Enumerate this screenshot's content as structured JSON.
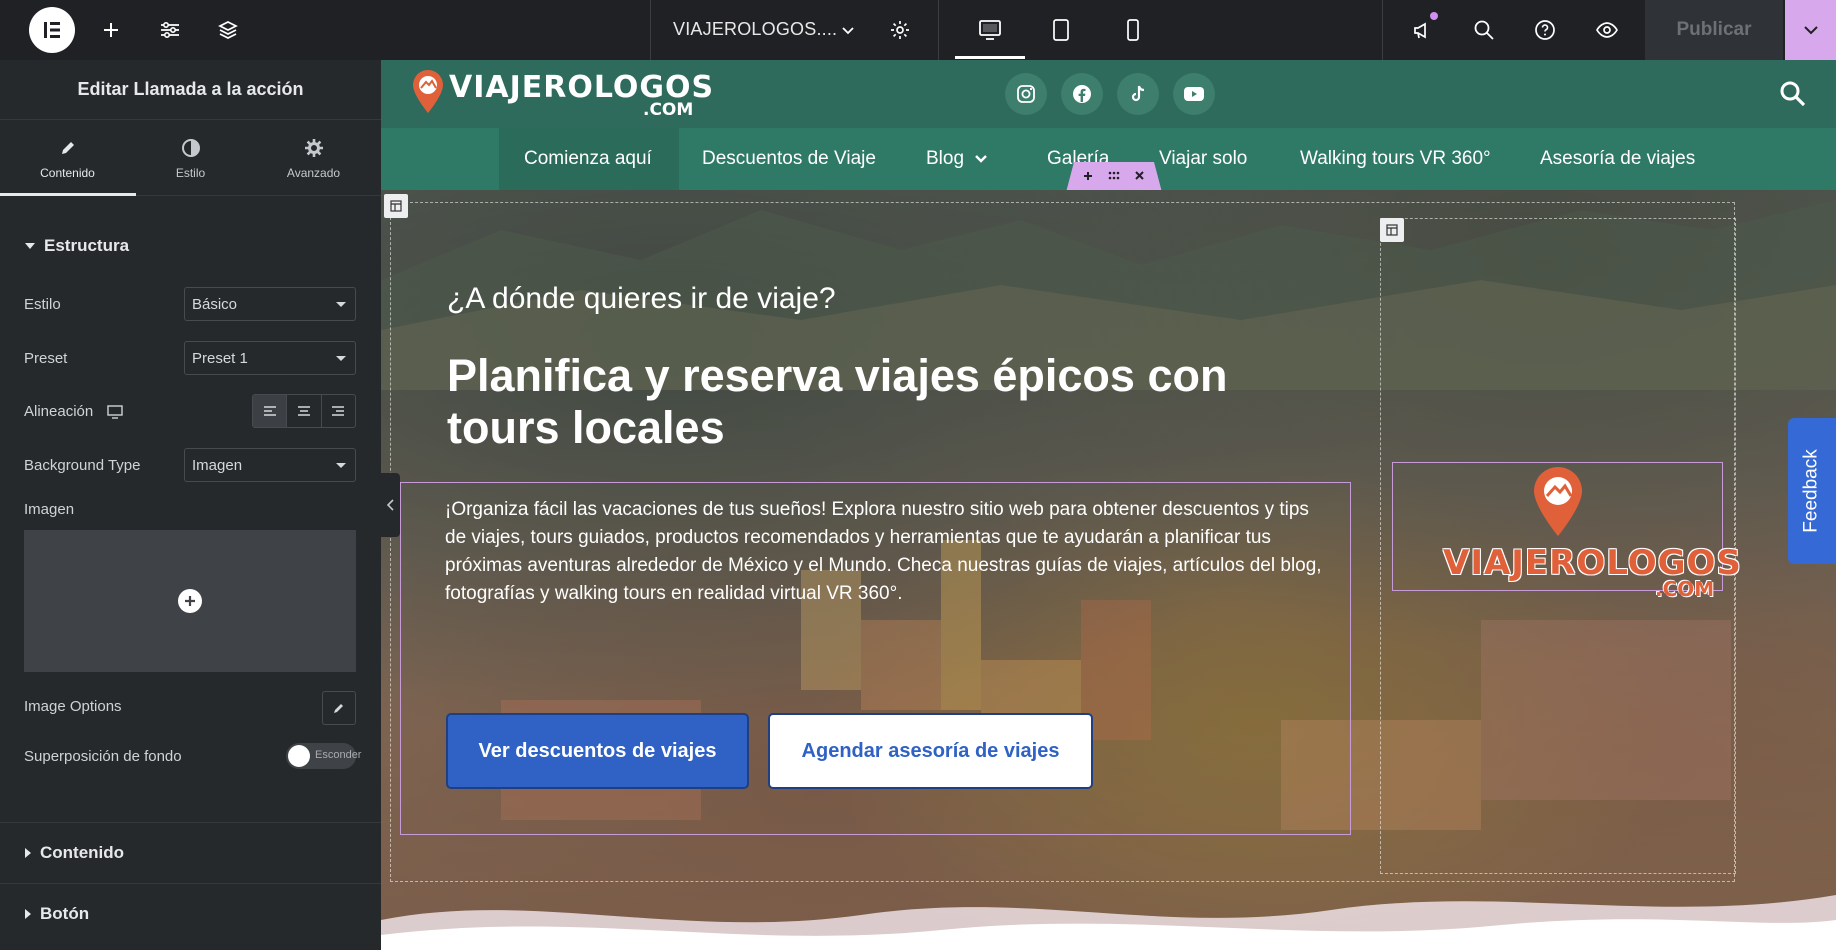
{
  "topbar": {
    "site_title": "VIAJEROLOGOS....",
    "publish_label": "Publicar"
  },
  "panel": {
    "title": "Editar Llamada a la acción",
    "tabs": [
      {
        "label": "Contenido",
        "icon": "pencil-icon"
      },
      {
        "label": "Estilo",
        "icon": "contrast-icon"
      },
      {
        "label": "Avanzado",
        "icon": "gear-icon"
      }
    ],
    "section_structure": "Estructura",
    "fields": {
      "style_label": "Estilo",
      "style_value": "Básico",
      "preset_label": "Preset",
      "preset_value": "Preset 1",
      "align_label": "Alineación",
      "bgtype_label": "Background Type",
      "bgtype_value": "Imagen",
      "image_label": "Imagen",
      "image_options_label": "Image Options",
      "overlay_label": "Superposición de fondo",
      "overlay_toggle": "Esconder"
    },
    "section_content": "Contenido",
    "section_button": "Botón"
  },
  "site": {
    "logo_main": "VIAJEROLOGOS",
    "logo_sub": ".COM",
    "nav": [
      "Comienza aquí",
      "Descuentos de Viaje",
      "Blog",
      "Galería",
      "Viajar solo",
      "Walking tours VR 360°",
      "Asesoría de viajes"
    ],
    "social_icons": [
      "instagram-icon",
      "facebook-icon",
      "tiktok-icon",
      "youtube-icon"
    ]
  },
  "hero": {
    "subtitle": "¿A dónde quieres ir de viaje?",
    "title": "Planifica y reserva viajes épicos con tours locales",
    "body": "¡Organiza fácil las vacaciones de tus sueños! Explora nuestro sitio web para obtener descuentos y tips de viajes, tours guiados, productos recomendados y herramientas que te ayudarán a planificar tus próximas aventuras alrededor de México y el Mundo. Checa nuestras guías de viajes, artículos del blog, fotografías y walking tours en realidad virtual VR 360°.",
    "btn_primary": "Ver descuentos de viajes",
    "btn_secondary": "Agendar asesoría de viajes",
    "logo_main": "VIAJEROLOGOS",
    "logo_sub": ".COM"
  },
  "feedback_label": "Feedback",
  "colors": {
    "editor_dark": "#1f2124",
    "panel": "#26292c",
    "site_green": "#2f7a66",
    "brand_orange": "#e0603a",
    "button_blue": "#2f62c4",
    "selection_pink": "#d7a9ec"
  }
}
